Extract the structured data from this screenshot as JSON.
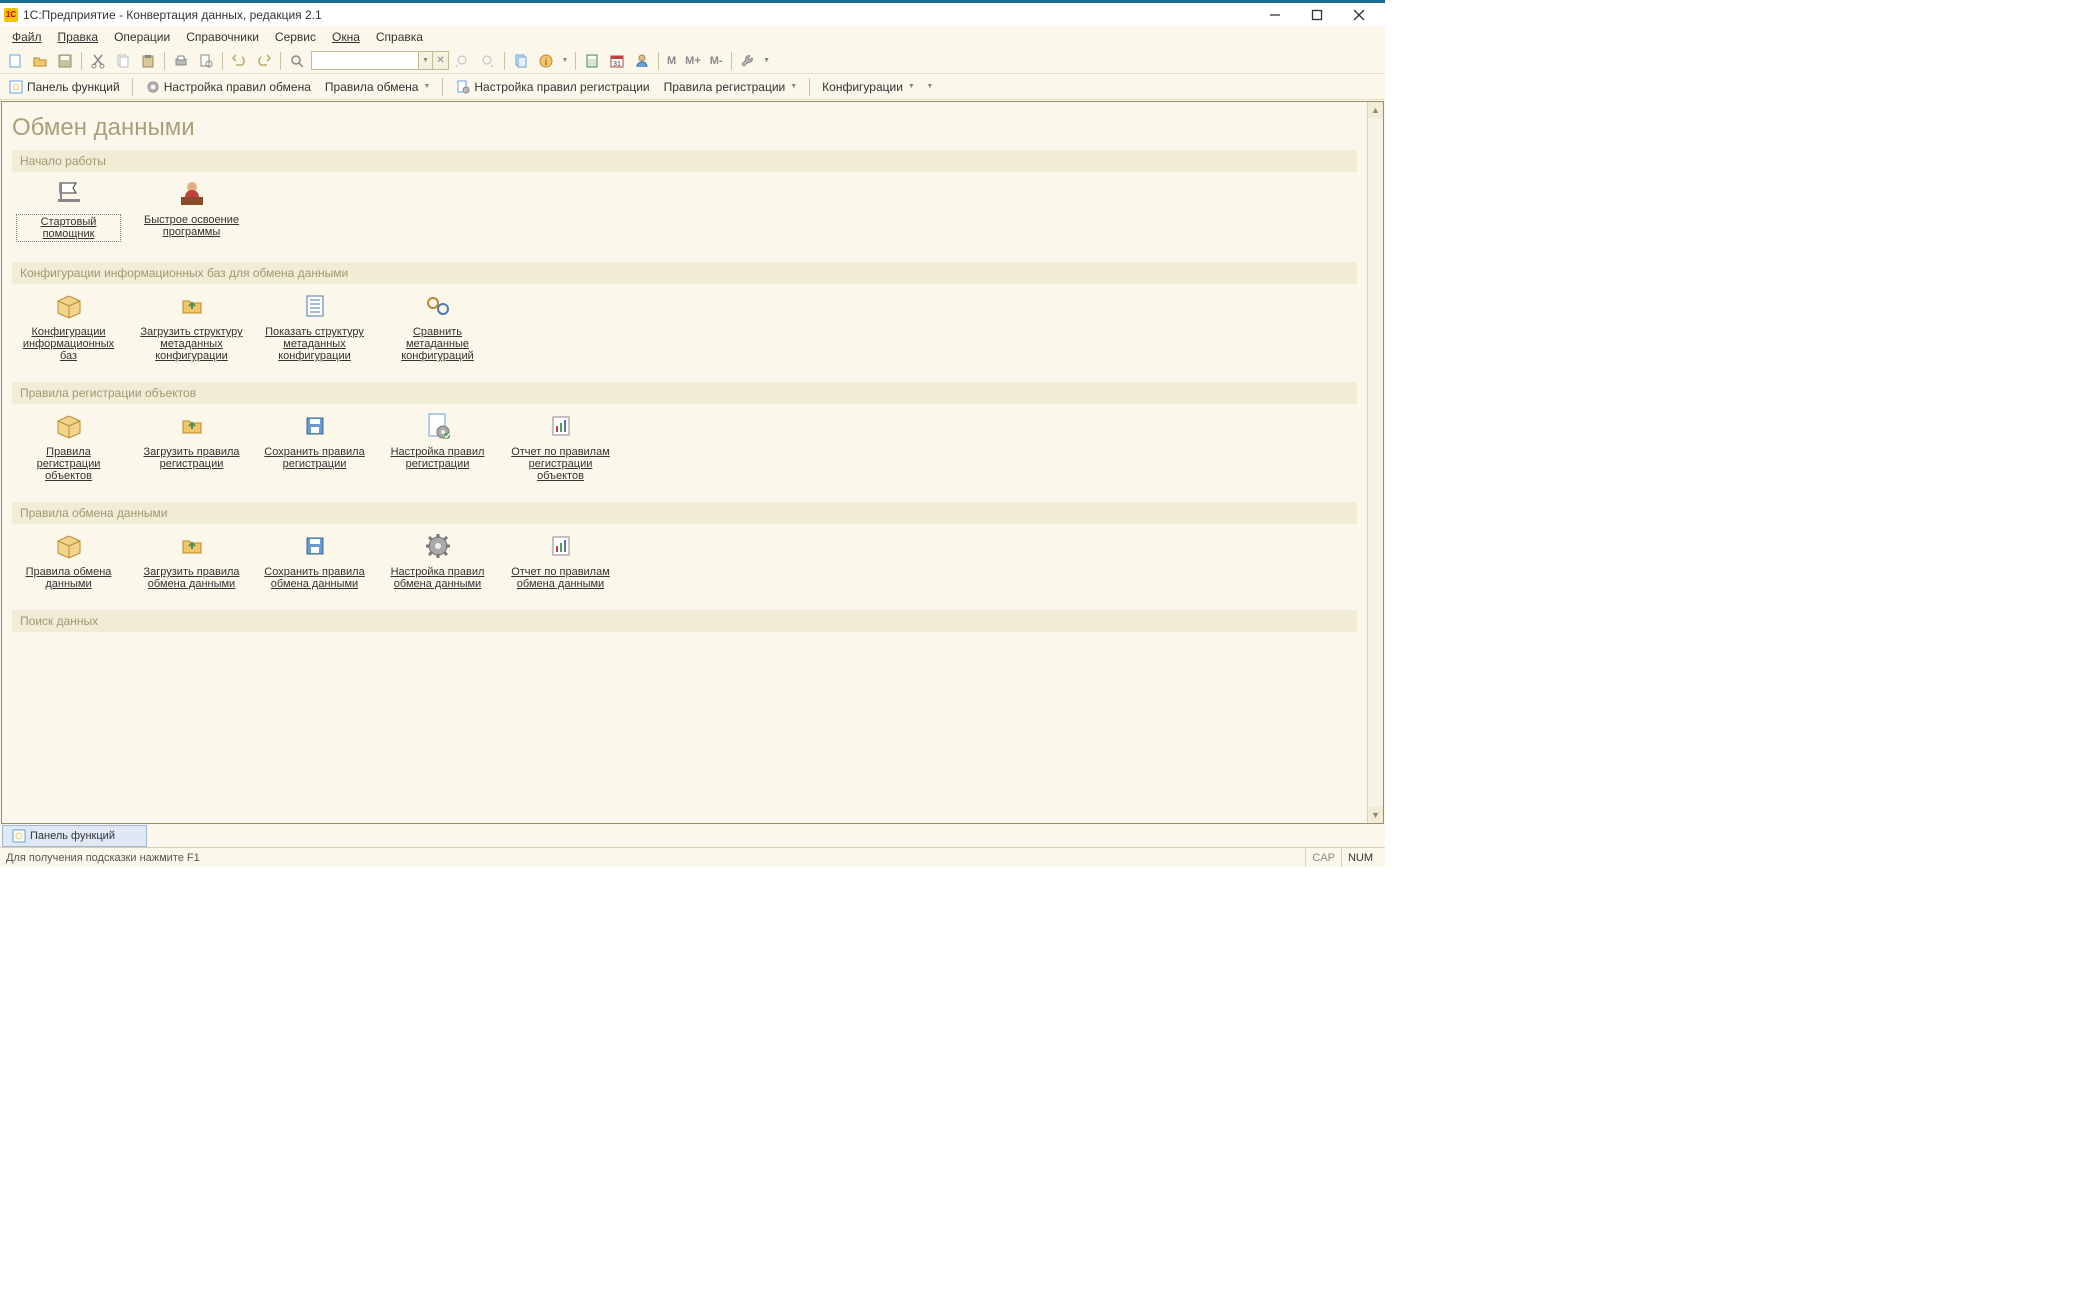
{
  "titlebar": {
    "title": "1С:Предприятие - Конвертация данных, редакция 2.1",
    "icon_text": "1C"
  },
  "menubar": {
    "items": [
      {
        "label": "Файл"
      },
      {
        "label": "Правка"
      },
      {
        "label": "Операции"
      },
      {
        "label": "Справочники"
      },
      {
        "label": "Сервис"
      },
      {
        "label": "Окна"
      },
      {
        "label": "Справка"
      }
    ]
  },
  "cmdbar": {
    "panel_functions": "Панель функций",
    "exchange_rules_setup": "Настройка правил обмена",
    "exchange_rules": "Правила обмена",
    "registration_rules_setup": "Настройка правил регистрации",
    "registration_rules": "Правила регистрации",
    "configurations": "Конфигурации"
  },
  "page": {
    "title": "Обмен данными",
    "sections": [
      {
        "header": "Начало работы",
        "tiles": [
          {
            "label": "Стартовый помощник",
            "icon": "flag",
            "selected": true
          },
          {
            "label": "Быстрое освоение программы",
            "icon": "person-book"
          }
        ]
      },
      {
        "header": "Конфигурации информационных баз для обмена данными",
        "tiles": [
          {
            "label": "Конфигурации информационных баз",
            "icon": "box"
          },
          {
            "label": "Загрузить структуру метаданных конфигурации",
            "icon": "folder-up"
          },
          {
            "label": "Показать структуру метаданных конфигурации",
            "icon": "list"
          },
          {
            "label": "Сравнить метаданные конфигураций",
            "icon": "compare"
          }
        ]
      },
      {
        "header": "Правила регистрации объектов",
        "tiles": [
          {
            "label": "Правила регистрации объектов",
            "icon": "box"
          },
          {
            "label": "Загрузить правила регистрации",
            "icon": "folder-up"
          },
          {
            "label": "Сохранить правила регистрации",
            "icon": "save"
          },
          {
            "label": " Настройка  правил регистрации",
            "icon": "gear-doc"
          },
          {
            "label": "Отчет по правилам регистрации объектов",
            "icon": "report"
          }
        ]
      },
      {
        "header": "Правила обмена данными",
        "tiles": [
          {
            "label": "Правила обмена данными",
            "icon": "box"
          },
          {
            "label": "Загрузить  правила обмена данными",
            "icon": "folder-up"
          },
          {
            "label": "Сохранить правила обмена данными",
            "icon": "save"
          },
          {
            "label": " Настройка  правил обмена данными",
            "icon": "gear"
          },
          {
            "label": "Отчет по правилам обмена данными",
            "icon": "report"
          }
        ]
      },
      {
        "header": "Поиск данных",
        "tiles": []
      }
    ]
  },
  "taskbar": {
    "tab": "Панель функций"
  },
  "statusbar": {
    "text": "Для получения подсказки нажмите F1",
    "cap": "CAP",
    "num": "NUM"
  },
  "toolbar_text": {
    "m": "M",
    "mplus": "M+",
    "mminus": "M-"
  }
}
